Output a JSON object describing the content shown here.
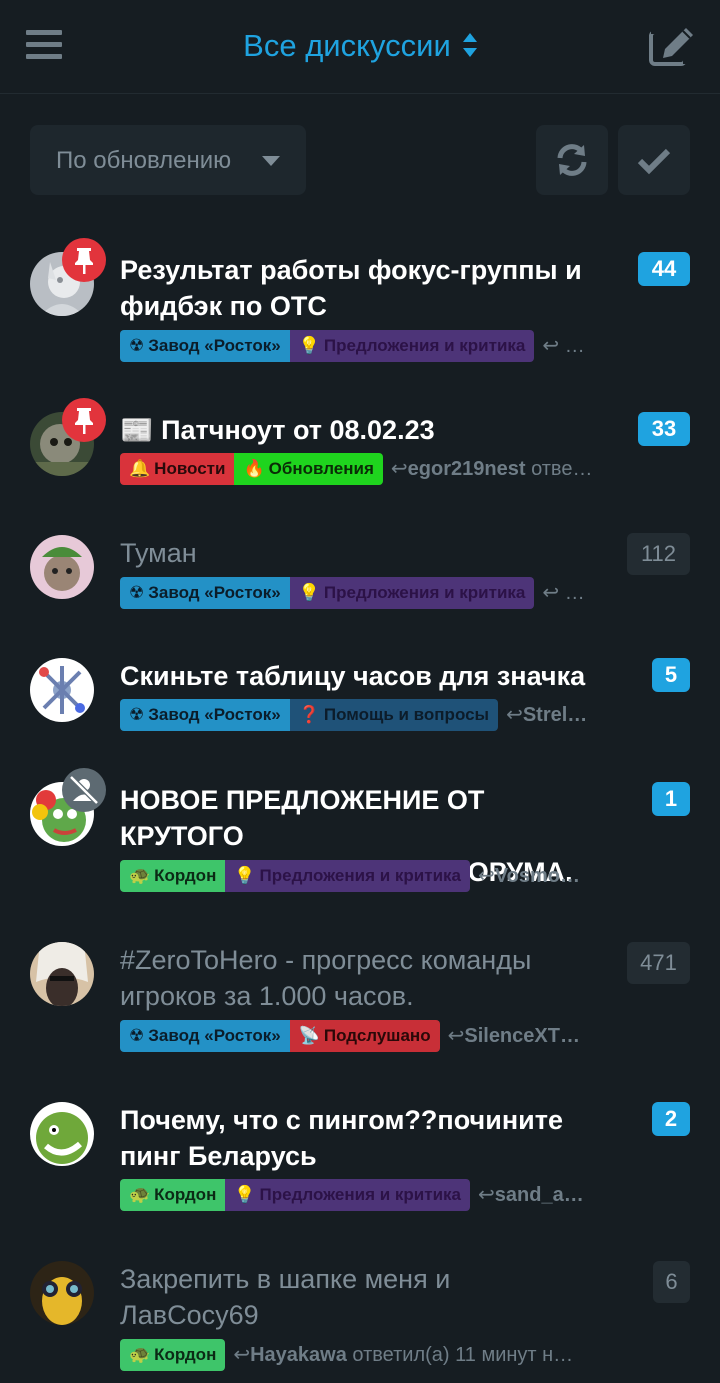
{
  "header": {
    "title": "Все дискуссии"
  },
  "toolbar": {
    "sort_label": "По обновлению"
  },
  "colors": {
    "background": "#161d22",
    "accent": "#1fa3e0",
    "unread_count": "#1fa3e0",
    "pin_badge": "#e2343c"
  },
  "discussions": [
    {
      "title_line1": "Результат работы фокус-группы и",
      "title_line2": "фидбэк по ОТС",
      "count": "44",
      "tag1": "Завод «Росток»",
      "tag2": "Предложения и критика",
      "reply_user": "",
      "reply_suffix": "…"
    },
    {
      "title_line1": "📰 Патчноут от 08.02.23",
      "count": "33",
      "tag1": "Новости",
      "tag2": "Обновления",
      "reply_user": "egor219nest",
      "reply_suffix": "отве…"
    },
    {
      "title_line1": "Туман",
      "count": "112",
      "tag1": "Завод «Росток»",
      "tag2": "Предложения и критика",
      "reply_user": "",
      "reply_suffix": "…"
    },
    {
      "title_line1": "Скиньте таблицу часов для значка",
      "count": "5",
      "tag1": "Завод «Росток»",
      "tag2": "Помощь и вопросы",
      "reply_user": "Strel…",
      "reply_suffix": ""
    },
    {
      "title_line1": "НОВОЕ ПРЕДЛОЖЕНИЕ ОТ КРУТОГО",
      "title_line2": "И КРАСИВОГО ПАЦАНА ФОРУМА.",
      "count": "1",
      "tag1": "Кордон",
      "tag2": "Предложения и критика",
      "reply_user": "Vosmo…",
      "reply_suffix": ""
    },
    {
      "title_line1": "#ZeroToHero - прогресс команды",
      "title_line2": "игроков за 1.000 часов.",
      "count": "471",
      "tag1": "Завод «Росток»",
      "tag2": "Подслушано",
      "reply_user": "SilenceXT…",
      "reply_suffix": ""
    },
    {
      "title_line1": "Почему, что с пингом??почините",
      "title_line2": "пинг Беларусь",
      "count": "2",
      "tag1": "Кордон",
      "tag2": "Предложения и критика",
      "reply_user": "sand_a…",
      "reply_suffix": ""
    },
    {
      "title_line1": "Закрепить в шапке меня и",
      "title_line2": "ЛавСосу69",
      "count": "6",
      "tag1": "Кордон",
      "reply_user": "Hayakawa",
      "reply_suffix": "ответил(а) 11 минут н…"
    }
  ]
}
